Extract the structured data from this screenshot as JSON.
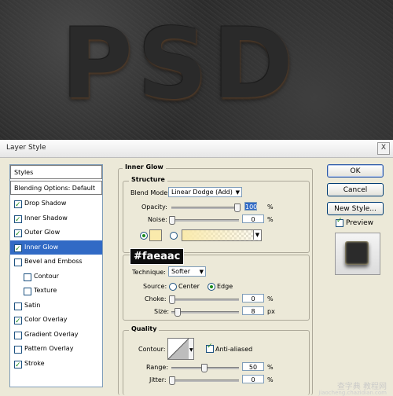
{
  "canvas": {
    "text": "PSD"
  },
  "dialog": {
    "title": "Layer Style",
    "close_label": "X"
  },
  "left_list": {
    "styles_header": "Styles",
    "blending_header": "Blending Options: Default",
    "items": [
      {
        "label": "Drop Shadow",
        "checked": true,
        "indent": false,
        "selected": false
      },
      {
        "label": "Inner Shadow",
        "checked": true,
        "indent": false,
        "selected": false
      },
      {
        "label": "Outer Glow",
        "checked": true,
        "indent": false,
        "selected": false
      },
      {
        "label": "Inner Glow",
        "checked": true,
        "indent": false,
        "selected": true
      },
      {
        "label": "Bevel and Emboss",
        "checked": false,
        "indent": false,
        "selected": false
      },
      {
        "label": "Contour",
        "checked": false,
        "indent": true,
        "selected": false
      },
      {
        "label": "Texture",
        "checked": false,
        "indent": true,
        "selected": false
      },
      {
        "label": "Satin",
        "checked": false,
        "indent": false,
        "selected": false
      },
      {
        "label": "Color Overlay",
        "checked": true,
        "indent": false,
        "selected": false
      },
      {
        "label": "Gradient Overlay",
        "checked": false,
        "indent": false,
        "selected": false
      },
      {
        "label": "Pattern Overlay",
        "checked": false,
        "indent": false,
        "selected": false
      },
      {
        "label": "Stroke",
        "checked": true,
        "indent": false,
        "selected": false
      }
    ]
  },
  "panel": {
    "section_title": "Inner Glow",
    "structure": {
      "title": "Structure",
      "blend_mode_label": "Blend Mode:",
      "blend_mode_value": "Linear Dodge (Add)",
      "opacity_label": "Opacity:",
      "opacity_value": "100",
      "opacity_unit": "%",
      "noise_label": "Noise:",
      "noise_value": "0",
      "noise_unit": "%",
      "glow_color": "#faeaac"
    },
    "elements": {
      "technique_label": "Technique:",
      "technique_value": "Softer",
      "source_label": "Source:",
      "source_center": "Center",
      "source_edge": "Edge",
      "choke_label": "Choke:",
      "choke_value": "0",
      "choke_unit": "%",
      "size_label": "Size:",
      "size_value": "8",
      "size_unit": "px"
    },
    "quality": {
      "title": "Quality",
      "contour_label": "Contour:",
      "anti_aliased_label": "Anti-aliased",
      "anti_aliased_checked": true,
      "range_label": "Range:",
      "range_value": "50",
      "range_unit": "%",
      "jitter_label": "Jitter:",
      "jitter_value": "0",
      "jitter_unit": "%"
    }
  },
  "annotation": {
    "hex": "#faeaac"
  },
  "buttons": {
    "ok": "OK",
    "cancel": "Cancel",
    "new_style": "New Style...",
    "preview": "Preview",
    "preview_checked": true
  },
  "watermark": {
    "text": "查字典 教程网",
    "url": "jiaocheng.chazidian.com"
  }
}
